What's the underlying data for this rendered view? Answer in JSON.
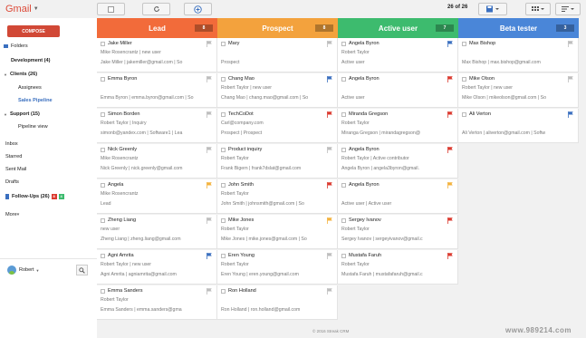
{
  "app": {
    "logo": "Gmail",
    "count": "26 of 26",
    "compose": "COMPOSE",
    "footer": "© 2016 Streak CRM",
    "watermark": "www.989214.com"
  },
  "sidebar": {
    "items": [
      {
        "label": "Folders",
        "style": "normal",
        "icon": "folder"
      },
      {
        "label": "Development (4)",
        "style": "bold",
        "indent": 1
      },
      {
        "label": "Clients (26)",
        "style": "bold",
        "arrow": true
      },
      {
        "label": "Assignees",
        "style": "normal",
        "indent": 2
      },
      {
        "label": "Sales Pipeline",
        "style": "blue",
        "indent": 2
      },
      {
        "label": "Support (15)",
        "style": "bold",
        "arrow": true
      },
      {
        "label": "Pipeline view",
        "style": "normal",
        "indent": 2
      },
      {
        "label": "Inbox",
        "style": "normal"
      },
      {
        "label": "Starred",
        "style": "normal"
      },
      {
        "label": "Sent Mail",
        "style": "normal"
      },
      {
        "label": "Drafts",
        "style": "normal"
      },
      {
        "label": "Follow-Ups (26)",
        "style": "bold",
        "icon": "flag"
      },
      {
        "label": "More",
        "style": "normal",
        "caret": true
      }
    ],
    "followup_badges": [
      "8",
      "4"
    ],
    "user": "Robert"
  },
  "columns": [
    {
      "title": "Lead",
      "count": "8",
      "color": "#f26b3a",
      "cards": [
        {
          "name": "Jake Miller",
          "l2": "Mike Rosencrantz | new user",
          "l3": "Jake Miller | jakemiller@gmail.com | So",
          "flag": "gray"
        },
        {
          "name": "Emma Byron",
          "l2": "",
          "l3": "Emma Byron | emma.byron@gmail.com | So",
          "flag": "gray"
        },
        {
          "name": "Simon Borden",
          "l2": "Robert Taylor | Inquiry",
          "l3": "simonb@yandex.com | Software1 | Lea",
          "flag": "gray"
        },
        {
          "name": "Nick Greenly",
          "l2": "Mike Rosencrantz",
          "l3": "Nick Greenly | nick.greenly@gmail.com",
          "flag": "gray"
        },
        {
          "name": "Angela",
          "l2": "Mike Rosencrantz",
          "l3": "Lead",
          "flag": "yellow"
        },
        {
          "name": "Zheng Liang",
          "l2": "new user",
          "l3": "Zheng Liang | zheng.liang@gmail.com",
          "flag": "gray"
        },
        {
          "name": "Agni Amrita",
          "l2": "Robert Taylor | new user",
          "l3": "Agni Amrita | agniamrita@gmail.com",
          "flag": "blue"
        },
        {
          "name": "Emma Sanders",
          "l2": "Robert Taylor",
          "l3": "Emma Sanders | emma.sanders@gma",
          "flag": "gray"
        }
      ]
    },
    {
      "title": "Prospect",
      "count": "8",
      "color": "#f3a23d",
      "cards": [
        {
          "name": "Mary",
          "l2": "",
          "l3": "Prospect",
          "flag": "gray"
        },
        {
          "name": "Chang Mao",
          "l2": "Robert Taylor | new user",
          "l3": "Chang Mao | chang.mao@gmail.com | So",
          "flag": "blue"
        },
        {
          "name": "TechCoDot",
          "l2": "Carl@company.com",
          "l3": "Prospect | Prospect",
          "flag": "red"
        },
        {
          "name": "Product inquiry",
          "l2": "Robert Taylor",
          "l3": "Frank Bigern | frank7dslat@gmail.com",
          "flag": "gray"
        },
        {
          "name": "John Smith",
          "l2": "Robert Taylor",
          "l3": "John Smith | johnsmith@gmail.com | So",
          "flag": "red"
        },
        {
          "name": "Mike Jones",
          "l2": "Robert Taylor",
          "l3": "Mike Jones | mike.jones@gmail.com | So",
          "flag": "yellow"
        },
        {
          "name": "Eren Young",
          "l2": "Robert Taylor",
          "l3": "Eren Young | eren.young@gmail.com",
          "flag": "gray"
        },
        {
          "name": "Ron Holland",
          "l2": "",
          "l3": "Ron Holland | ron.holland@gmail.com",
          "flag": "gray"
        }
      ]
    },
    {
      "title": "Active user",
      "count": "7",
      "color": "#3dbb6e",
      "cards": [
        {
          "name": "Angela Byron",
          "l2": "Robert Taylor",
          "l3": "Active user",
          "flag": "blue"
        },
        {
          "name": "Angela Byron",
          "l2": "",
          "l3": "Active user",
          "flag": "red"
        },
        {
          "name": "Miranda Gregson",
          "l2": "Robert Taylor",
          "l3": "Miranga Gregson | mirandagregson@",
          "flag": "red"
        },
        {
          "name": "Angela Byron",
          "l2": "Robert Taylor | Active contributor",
          "l3": "Angela Byron | angela3byron@gmail.",
          "flag": "red"
        },
        {
          "name": "Angela Byron",
          "l2": "",
          "l3": "Active user | Active user",
          "flag": "yellow"
        },
        {
          "name": "Sergey Ivanov",
          "l2": "Robert Taylor",
          "l3": "Sergey Ivanov | sergeyivanov@gmail.c",
          "flag": "red"
        },
        {
          "name": "Mustafa Faruh",
          "l2": "Robert Taylor",
          "l3": "Mustafa Faruh | mustafafaruh@gmail.c",
          "flag": "red"
        }
      ]
    },
    {
      "title": "Beta tester",
      "count": "3",
      "color": "#4a86d8",
      "cards": [
        {
          "name": "Max Bishop",
          "l2": "",
          "l3": "Max Bishop | max.bishop@gmail.com",
          "flag": "gray"
        },
        {
          "name": "Mike Olson",
          "l2": "Robert Taylor | new user",
          "l3": "Mike Olson | mikeolson@gmail.com | So",
          "flag": "gray"
        },
        {
          "name": "Ali Verton",
          "l2": "",
          "l3": "Ali Verton | aliverton@gmail.com | Softw",
          "flag": "blue"
        }
      ]
    }
  ],
  "flag_colors": {
    "gray": "#bdbdbd",
    "blue": "#3a6fbf",
    "red": "#db3a2f",
    "yellow": "#f3b23d"
  }
}
